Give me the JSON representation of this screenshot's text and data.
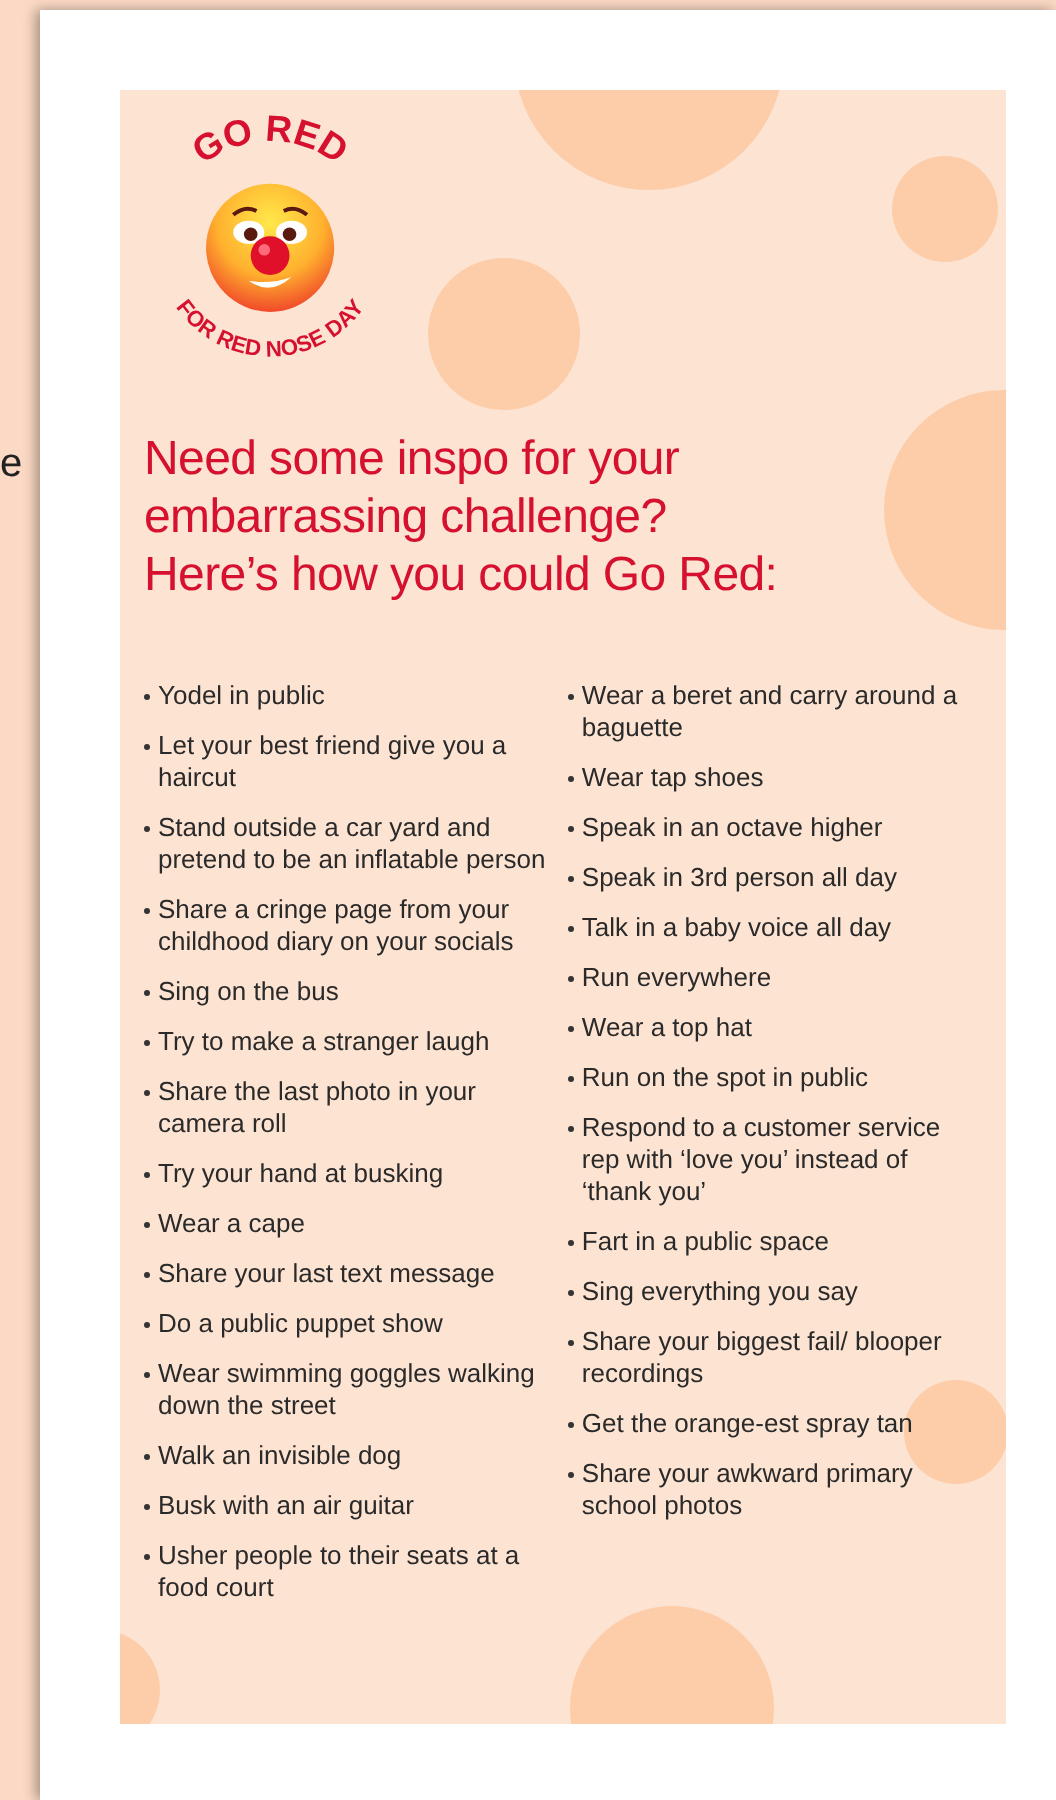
{
  "edge_text": "e",
  "logo": {
    "top_text": "GO RED",
    "bottom_text": "FOR RED NOSE DAY"
  },
  "heading": [
    "Need some inspo for your",
    "embarrassing challenge?",
    "Here’s how you could Go Red:"
  ],
  "columns": [
    [
      "Yodel in public",
      "Let your best friend give you a haircut",
      "Stand outside a car yard and pretend to be an inflatable person",
      "Share a cringe page from your childhood diary on your socials",
      "Sing on the bus",
      "Try to make a stranger laugh",
      "Share the last photo in your camera roll",
      "Try your hand at busking",
      "Wear a cape",
      "Share your last text message",
      "Do a public puppet show",
      "Wear swimming goggles walking down the street",
      "Walk an invisible dog",
      "Busk with an air guitar",
      "Usher people to their seats at a food court"
    ],
    [
      "Wear a beret and carry around a baguette",
      "Wear tap shoes",
      "Speak in an octave higher",
      "Speak in 3rd person all day",
      "Talk in a baby voice all day",
      "Run everywhere",
      "Wear a top hat",
      "Run on the spot in public",
      "Respond to a customer service rep with ‘love you’ instead of ‘thank you’",
      "Fart in a public space",
      "Sing everything you say",
      "Share your biggest fail/ blooper recordings",
      "Get the orange-est spray tan",
      "Share your awkward primary school photos"
    ]
  ]
}
